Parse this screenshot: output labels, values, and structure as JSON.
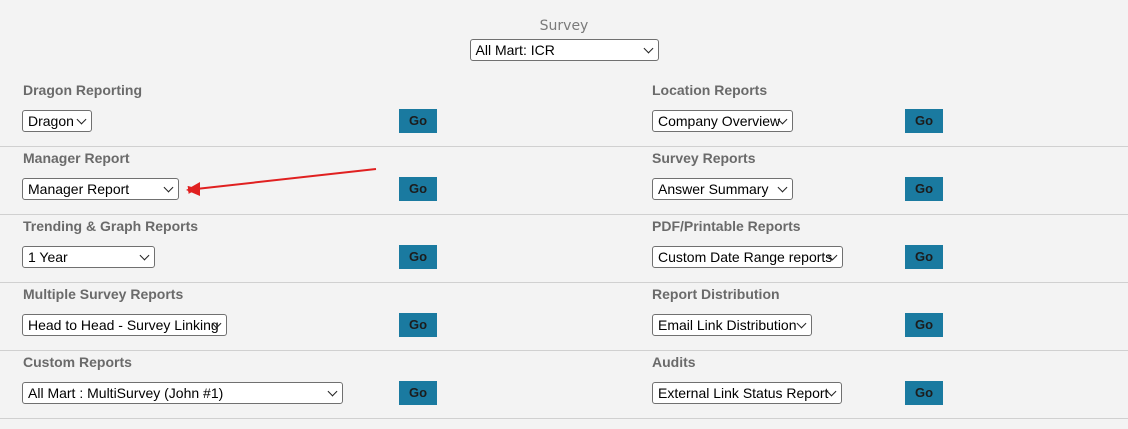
{
  "survey": {
    "label": "Survey",
    "selected": "All Mart: ICR"
  },
  "go_label": "Go",
  "left": [
    {
      "label": "Dragon Reporting",
      "selected": "Dragon"
    },
    {
      "label": "Manager Report",
      "selected": "Manager Report"
    },
    {
      "label": "Trending & Graph Reports",
      "selected": "1 Year"
    },
    {
      "label": "Multiple Survey Reports",
      "selected": "Head to Head - Survey Linking"
    },
    {
      "label": "Custom Reports",
      "selected": "All Mart : MultiSurvey (John #1)"
    }
  ],
  "right": [
    {
      "label": "Location Reports",
      "selected": "Company Overview"
    },
    {
      "label": "Survey Reports",
      "selected": "Answer Summary"
    },
    {
      "label": "PDF/Printable Reports",
      "selected": "Custom Date Range reports"
    },
    {
      "label": "Report Distribution",
      "selected": "Email Link Distribution"
    },
    {
      "label": "Audits",
      "selected": "External Link Status Report"
    }
  ],
  "colors": {
    "go_button": "#1a7aa0",
    "annotation_arrow": "#e02020"
  }
}
